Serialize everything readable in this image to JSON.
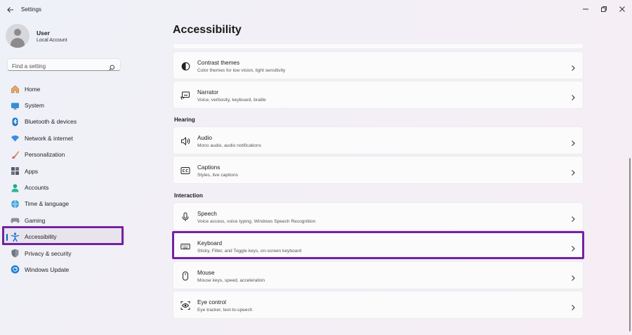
{
  "window": {
    "title": "Settings"
  },
  "profile": {
    "name": "User",
    "account_type": "Local Account"
  },
  "search": {
    "placeholder": "Find a setting",
    "icon": "search-icon"
  },
  "sidebar": {
    "items": [
      {
        "label": "Home",
        "icon": "home-icon"
      },
      {
        "label": "System",
        "icon": "system-icon"
      },
      {
        "label": "Bluetooth & devices",
        "icon": "bluetooth-icon"
      },
      {
        "label": "Network & internet",
        "icon": "wifi-icon"
      },
      {
        "label": "Personalization",
        "icon": "brush-icon"
      },
      {
        "label": "Apps",
        "icon": "apps-icon"
      },
      {
        "label": "Accounts",
        "icon": "accounts-icon"
      },
      {
        "label": "Time & language",
        "icon": "globe-icon"
      },
      {
        "label": "Gaming",
        "icon": "gamepad-icon"
      },
      {
        "label": "Accessibility",
        "icon": "accessibility-icon",
        "selected": true
      },
      {
        "label": "Privacy & security",
        "icon": "shield-icon"
      },
      {
        "label": "Windows Update",
        "icon": "update-icon"
      }
    ]
  },
  "main": {
    "title": "Accessibility",
    "vision_cards": [
      {
        "title": "Contrast themes",
        "subtitle": "Color themes for low vision, light sensitivity",
        "icon": "contrast-icon"
      },
      {
        "title": "Narrator",
        "subtitle": "Voice, verbosity, keyboard, braille",
        "icon": "narrator-icon"
      }
    ],
    "hearing": {
      "label": "Hearing",
      "cards": [
        {
          "title": "Audio",
          "subtitle": "Mono audio, audio notifications",
          "icon": "speaker-icon"
        },
        {
          "title": "Captions",
          "subtitle": "Styles, live captions",
          "icon": "captions-icon"
        }
      ]
    },
    "interaction": {
      "label": "Interaction",
      "cards": [
        {
          "title": "Speech",
          "subtitle": "Voice access, voice typing, Windows Speech Recognition",
          "icon": "microphone-icon"
        },
        {
          "title": "Keyboard",
          "subtitle": "Sticky, Filter, and Toggle keys, on-screen keyboard",
          "icon": "keyboard-icon",
          "highlighted": true
        },
        {
          "title": "Mouse",
          "subtitle": "Mouse keys, speed, acceleration",
          "icon": "mouse-icon"
        },
        {
          "title": "Eye control",
          "subtitle": "Eye tracker, text-to-speech",
          "icon": "eye-control-icon"
        }
      ]
    }
  },
  "colors": {
    "accent": "#0067c0",
    "highlight_outline": "#7422a0"
  }
}
